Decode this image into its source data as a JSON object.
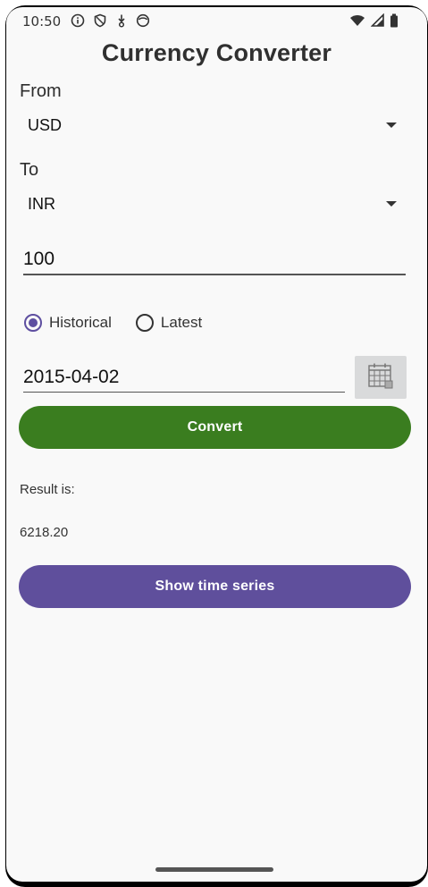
{
  "status_bar": {
    "time": "10:50",
    "left_icons": [
      "info-icon",
      "shield-icon",
      "download-icon",
      "face-icon"
    ],
    "right_icons": [
      "wifi-icon",
      "signal-icon",
      "battery-icon"
    ]
  },
  "app": {
    "title": "Currency Converter"
  },
  "from": {
    "label": "From",
    "selected": "USD"
  },
  "to": {
    "label": "To",
    "selected": "INR"
  },
  "amount": {
    "value": "100"
  },
  "mode": {
    "options": [
      {
        "label": "Historical",
        "selected": true
      },
      {
        "label": "Latest",
        "selected": false
      }
    ]
  },
  "date": {
    "value": "2015-04-02"
  },
  "buttons": {
    "convert": "Convert",
    "time_series": "Show time series"
  },
  "result": {
    "label": "Result is:",
    "value": "6218.20"
  },
  "colors": {
    "convert_button": "#3a7d1f",
    "time_series_button": "#5f4f9c",
    "accent": "#5e4fa0"
  }
}
